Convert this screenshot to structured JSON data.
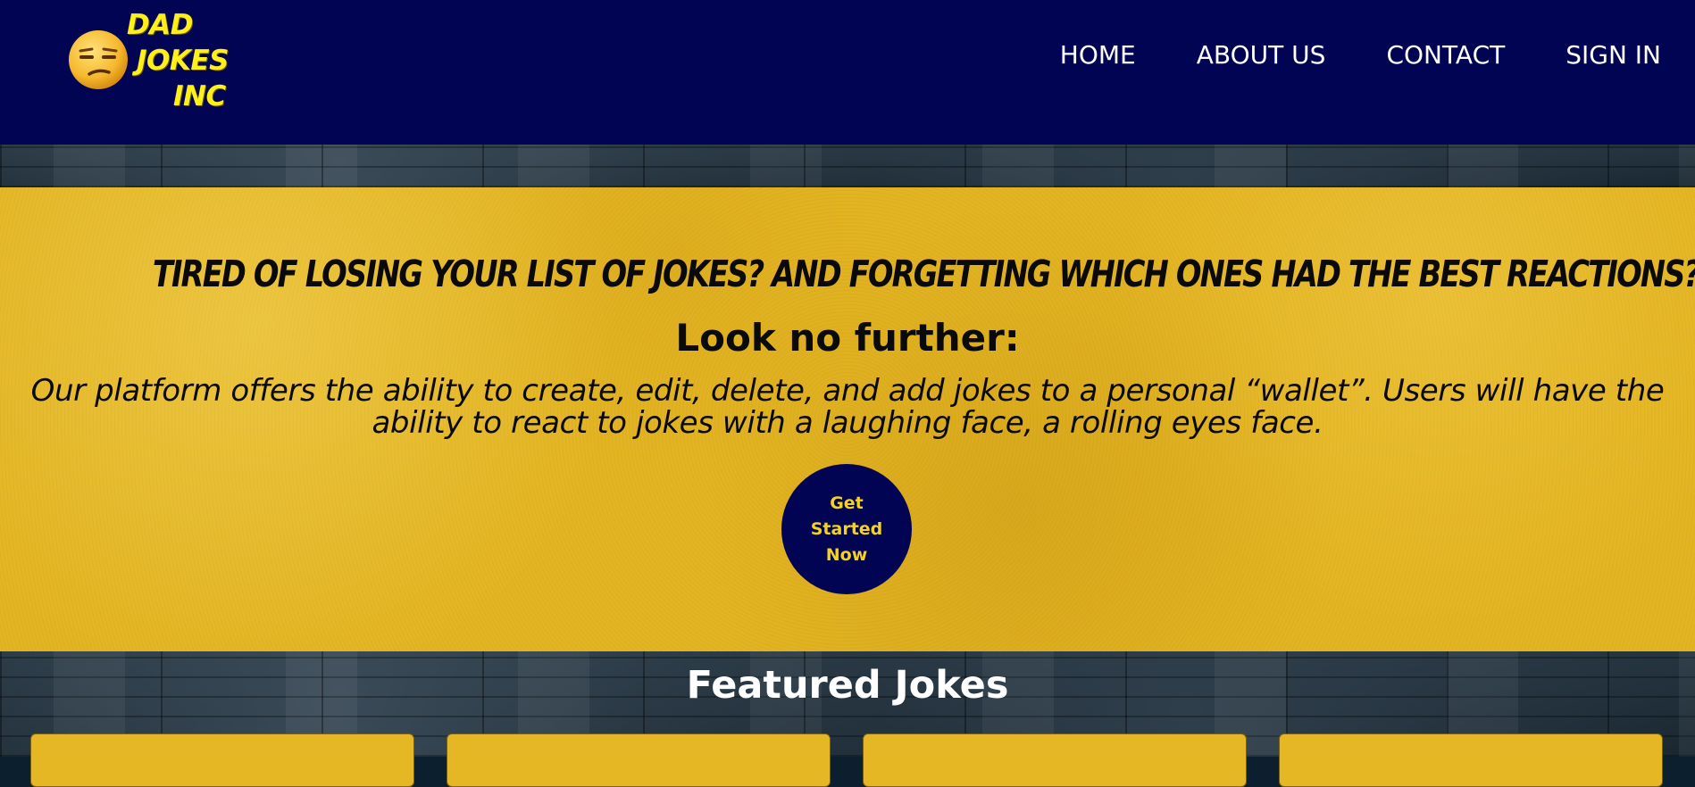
{
  "brand": {
    "line1": "DAD",
    "line2": "JOKES",
    "line3": "INC",
    "logo_icon": "unamused-face-icon"
  },
  "nav": {
    "items": [
      {
        "label": "HOME"
      },
      {
        "label": "ABOUT US"
      },
      {
        "label": "CONTACT"
      },
      {
        "label": "SIGN IN"
      }
    ]
  },
  "hero": {
    "heading": "TIRED OF LOSING YOUR LIST OF JOKES? AND FORGETTING WHICH ONES HAD THE BEST REACTIONS?",
    "subheading": "Look no further:",
    "description": "Our platform offers the ability to create, edit, delete, and add jokes to a personal “wallet”. Users will have the ability to react to jokes with a laughing face, a rolling eyes face.",
    "cta_label": "Get Started Now"
  },
  "featured": {
    "title": "Featured Jokes",
    "card_count": 4
  },
  "colors": {
    "nav_bg": "#000453",
    "brand_yellow": "#ffef1a",
    "hero_yellow": "#e3b422",
    "cta_text": "#f5d21f"
  }
}
